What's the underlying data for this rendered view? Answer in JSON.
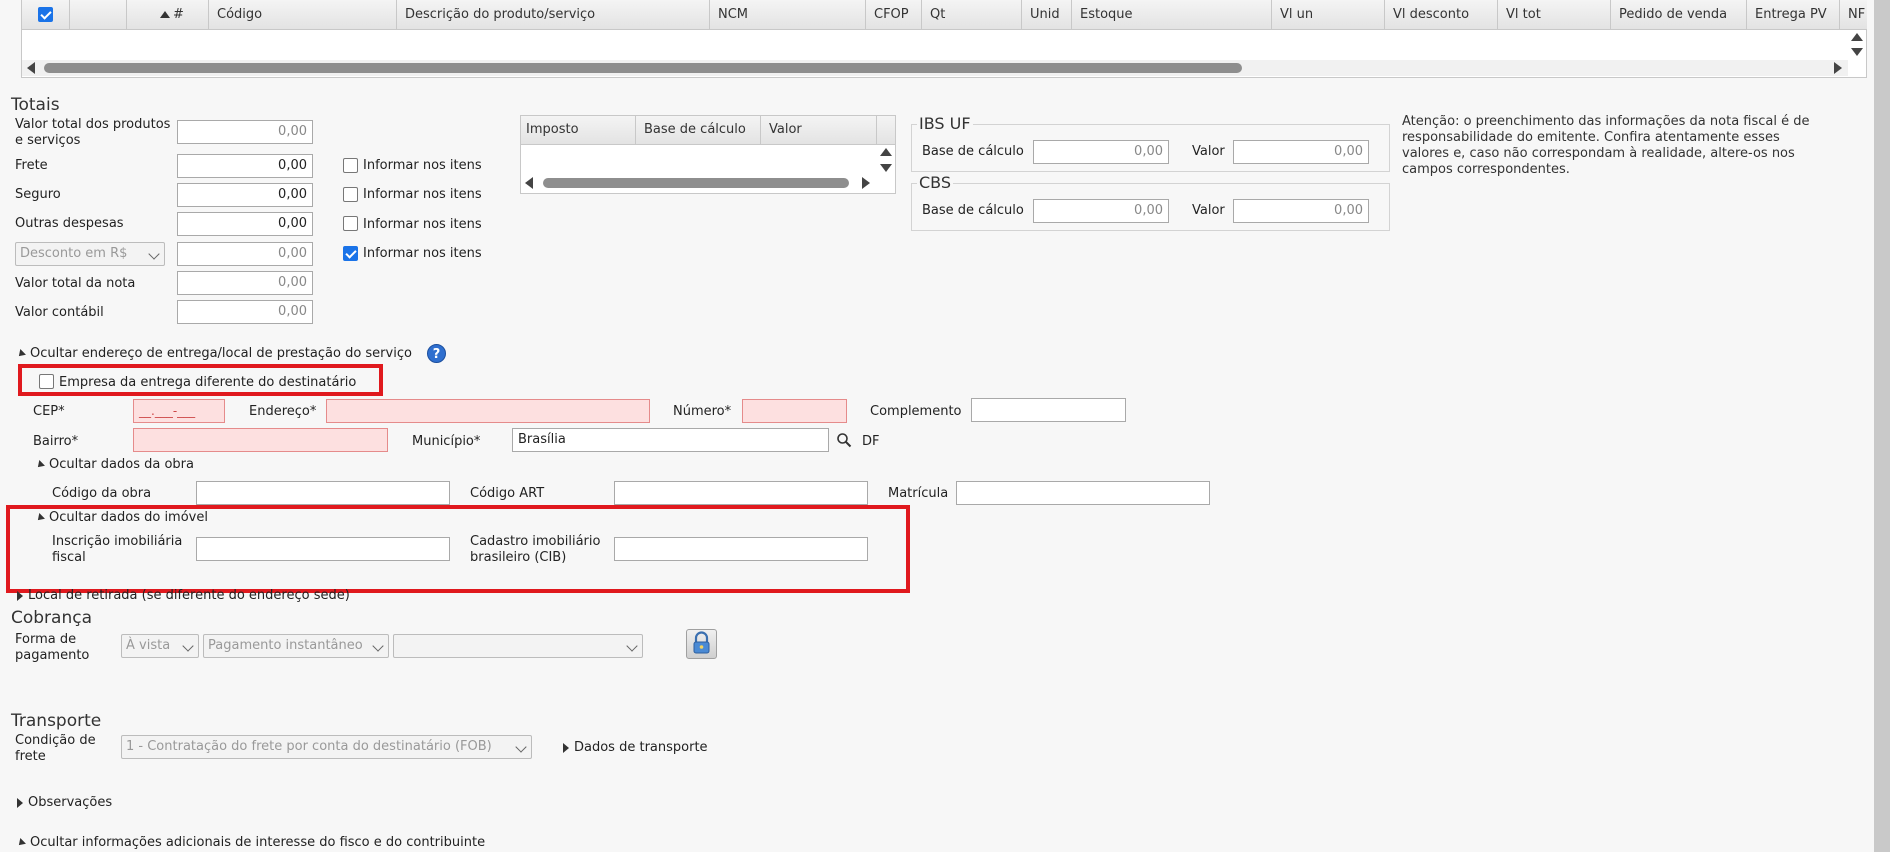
{
  "grid": {
    "columns": [
      "",
      "",
      "#",
      "Código",
      "Descrição do produto/serviço",
      "NCM",
      "CFOP",
      "Qt",
      "Unid",
      "Estoque",
      "Vl un",
      "Vl desconto",
      "Vl tot",
      "Pedido de venda",
      "Entrega PV",
      "NF R"
    ],
    "select_all_checked": true,
    "sort_column": "#"
  },
  "totais": {
    "title": "Totais",
    "valor_total_produtos_label": "Valor total dos produtos e serviços",
    "valor_total_produtos": "0,00",
    "frete_label": "Frete",
    "frete": "0,00",
    "seguro_label": "Seguro",
    "seguro": "0,00",
    "outras_despesas_label": "Outras despesas",
    "outras_despesas": "0,00",
    "desconto_select": "Desconto em R$",
    "desconto": "0,00",
    "valor_total_nota_label": "Valor total da nota",
    "valor_total_nota": "0,00",
    "valor_contabil_label": "Valor contábil",
    "valor_contabil": "0,00",
    "informar_label": "Informar nos itens",
    "informar_checks": [
      false,
      false,
      false,
      true
    ]
  },
  "impostos": {
    "columns": [
      "Imposto",
      "Base de cálculo",
      "Valor"
    ]
  },
  "ibs_uf": {
    "legend": "IBS UF",
    "base_label": "Base de cálculo",
    "base_value": "0,00",
    "valor_label": "Valor",
    "valor_value": "0,00"
  },
  "cbs": {
    "legend": "CBS",
    "base_label": "Base de cálculo",
    "base_value": "0,00",
    "valor_label": "Valor",
    "valor_value": "0,00"
  },
  "atencao": "Atenção: o preenchimento das informações da nota fiscal é de responsabilidade do emitente. Confira atentamente esses valores e, caso não correspondam à realidade, altere-os nos campos correspondentes.",
  "entrega": {
    "toggle_label": "Ocultar endereço de entrega/local de prestação do serviço",
    "help": "?",
    "empresa_diferente_label": "Empresa da entrega diferente do destinatário",
    "cep_label": "CEP*",
    "cep_value": "__.___-___",
    "endereco_label": "Endereço*",
    "numero_label": "Número*",
    "complemento_label": "Complemento",
    "bairro_label": "Bairro*",
    "municipio_label": "Município*",
    "municipio_value": "Brasília",
    "uf": "DF"
  },
  "obra": {
    "toggle_label": "Ocultar dados da obra",
    "codigo_obra_label": "Código da obra",
    "codigo_art_label": "Código ART",
    "matricula_label": "Matrícula"
  },
  "imovel": {
    "toggle_label": "Ocultar dados do imóvel",
    "inscricao_label": "Inscrição imobiliária fiscal",
    "cadastro_label": "Cadastro imobiliário brasileiro (CIB)"
  },
  "retirada": {
    "toggle_label": "Local de retirada (se diferente do endereço sede)"
  },
  "cobranca": {
    "title": "Cobrança",
    "forma_label": "Forma de pagamento",
    "condicao": "À vista",
    "meio": "Pagamento instantâneo",
    "extra": ""
  },
  "transporte": {
    "title": "Transporte",
    "condicao_label": "Condição de frete",
    "condicao_value": "1 - Contratação do frete por conta do destinatário (FOB)",
    "dados_label": "Dados de transporte"
  },
  "observacoes": {
    "toggle_label": "Observações"
  },
  "info_adicionais": {
    "toggle_label": "Ocultar informações adicionais de interesse do fisco e do contribuinte"
  },
  "colors": {
    "highlight": "#e0191e",
    "checkbox_checked": "#1a73e8",
    "required_bg": "#fde0e0"
  }
}
